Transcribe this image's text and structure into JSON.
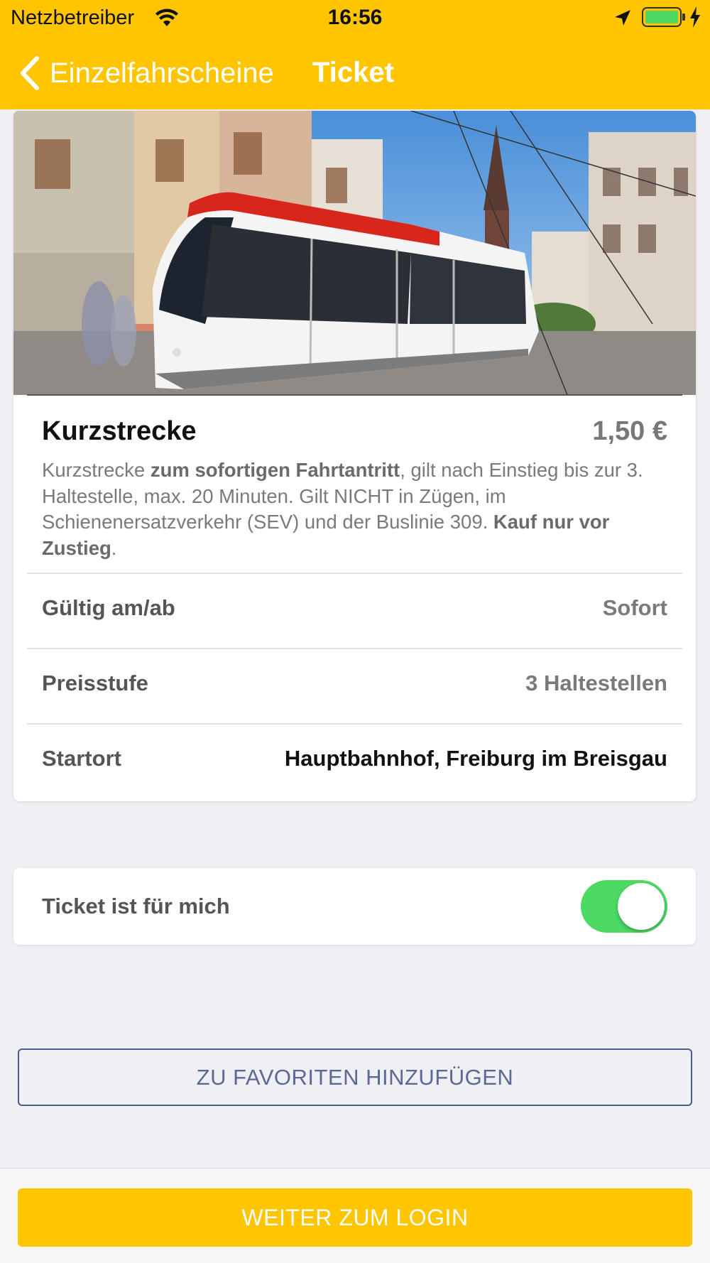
{
  "status_bar": {
    "carrier": "Netzbetreiber",
    "time": "16:56",
    "battery_level": 1.0
  },
  "nav": {
    "back_label": "Einzelfahrscheine",
    "title": "Ticket"
  },
  "ticket": {
    "name": "Kurzstrecke",
    "price": "1,50 €",
    "description": {
      "p1": "Kurzstrecke ",
      "b1": "zum sofortigen Fahrtantritt",
      "p2": ", gilt nach Einstieg bis zur 3. Haltestelle, max. 20 Minuten. Gilt NICHT in Zügen, im Schienenersatzverkehr (SEV) und der Buslinie 309. ",
      "b2": "Kauf nur vor Zustieg",
      "p3": "."
    },
    "rows": [
      {
        "label": "Gültig am/ab",
        "value": "Sofort"
      },
      {
        "label": "Preisstufe",
        "value": "3 Haltestellen"
      },
      {
        "label": "Startort",
        "value": "Hauptbahnhof, Freiburg im Breisgau"
      }
    ]
  },
  "for_me": {
    "label": "Ticket ist für mich",
    "enabled": true
  },
  "buttons": {
    "favorites": "ZU FAVORITEN HINZUFÜGEN",
    "login": "WEITER ZUM LOGIN"
  },
  "colors": {
    "brand_yellow": "#ffc500",
    "toggle_on": "#4cd964",
    "outline_blue": "#4a5b86"
  },
  "icons": [
    "wifi-icon",
    "location-arrow-icon",
    "battery-icon",
    "charging-bolt-icon",
    "chevron-left-icon"
  ]
}
